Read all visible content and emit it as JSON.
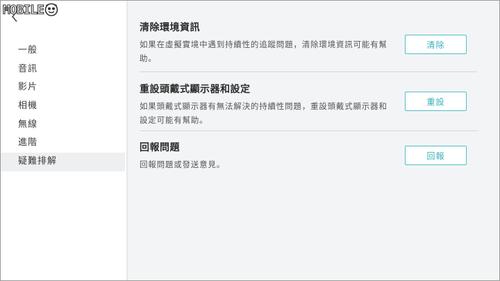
{
  "logo": {
    "text": "MOBILE"
  },
  "sidebar": {
    "items": [
      {
        "label": "一般"
      },
      {
        "label": "音訊"
      },
      {
        "label": "影片"
      },
      {
        "label": "相機"
      },
      {
        "label": "無線"
      },
      {
        "label": "進階"
      },
      {
        "label": "疑難排解",
        "selected": true
      }
    ]
  },
  "sections": [
    {
      "title": "清除環境資訊",
      "description": "如果在虛擬實境中遇到持續性的追蹤問題，清除環境資訊可能有幫助。",
      "button": "清除"
    },
    {
      "title": "重設頭戴式顯示器和設定",
      "description": "如果頭戴式顯示器有無法解決的持續性問題，重設頭戴式顯示器和設定可能有幫助。",
      "button": "重設"
    },
    {
      "title": "回報問題",
      "description": "回報問題或發送意見。",
      "button": "回報"
    }
  ],
  "colors": {
    "accent": "#4fc0c4",
    "panel_bg": "#f3f4f6",
    "sidebar_selected_bg": "#eeeff1"
  },
  "icons": [
    "back-chevron-icon",
    "logo-face-icon"
  ]
}
